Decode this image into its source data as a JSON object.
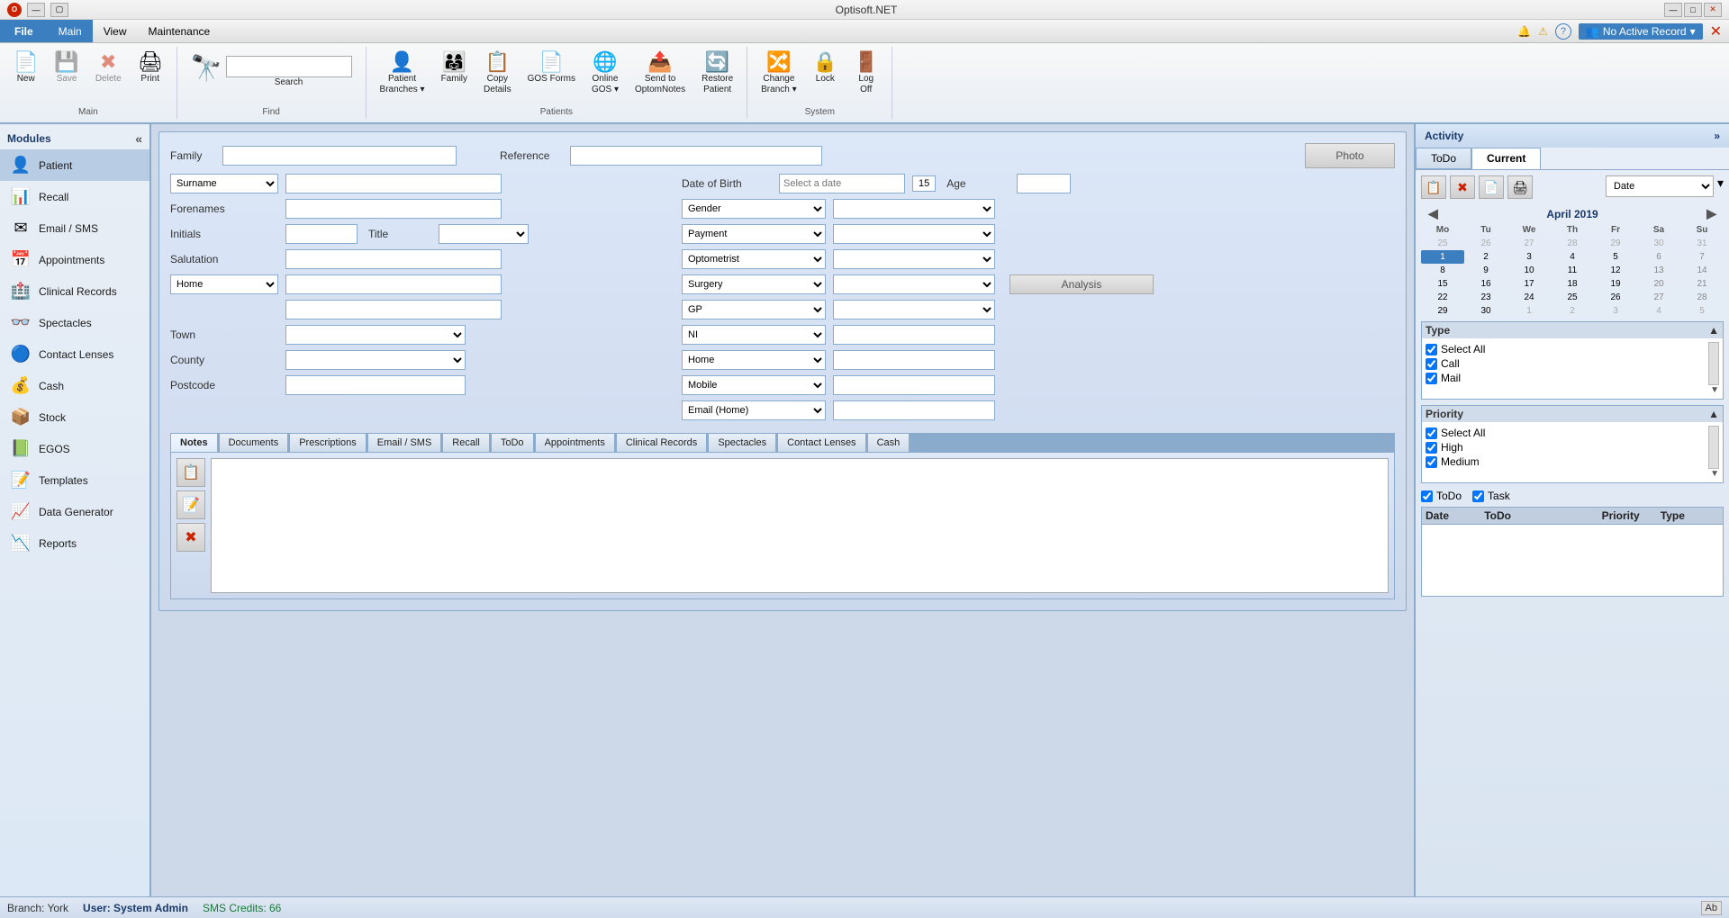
{
  "app": {
    "title": "Optisoft.NET",
    "minimize": "—",
    "maximize": "□",
    "close": "✕"
  },
  "menu": {
    "items": [
      {
        "id": "file",
        "label": "File",
        "active": false
      },
      {
        "id": "main",
        "label": "Main",
        "active": true
      },
      {
        "id": "view",
        "label": "View",
        "active": false
      },
      {
        "id": "maintenance",
        "label": "Maintenance",
        "active": false
      }
    ]
  },
  "ribbon": {
    "groups": [
      {
        "id": "main",
        "label": "Main",
        "buttons": [
          {
            "id": "new",
            "label": "New",
            "icon": "📄",
            "enabled": true
          },
          {
            "id": "save",
            "label": "Save",
            "icon": "💾",
            "enabled": false
          },
          {
            "id": "delete",
            "label": "Delete",
            "icon": "✖",
            "enabled": false
          },
          {
            "id": "print",
            "label": "Print",
            "icon": "🖨",
            "enabled": true
          }
        ]
      },
      {
        "id": "find",
        "label": "Find",
        "has_search": true,
        "search_placeholder": ""
      },
      {
        "id": "patients",
        "label": "Patients",
        "buttons": [
          {
            "id": "patient-branches",
            "label": "Patient Branches",
            "icon": "👤",
            "enabled": true
          },
          {
            "id": "family",
            "label": "Family",
            "icon": "👨‍👩‍👧",
            "enabled": true
          },
          {
            "id": "copy-details",
            "label": "Copy Details",
            "icon": "📋",
            "enabled": true
          },
          {
            "id": "gos-forms",
            "label": "GOS Forms",
            "icon": "📄",
            "enabled": true
          },
          {
            "id": "online-gos",
            "label": "Online GOS",
            "icon": "🌐",
            "enabled": true
          },
          {
            "id": "send-to-optom",
            "label": "Send to OptomNotes",
            "icon": "📤",
            "enabled": true
          },
          {
            "id": "restore-patient",
            "label": "Restore Patient",
            "icon": "🔄",
            "enabled": true
          }
        ]
      },
      {
        "id": "system",
        "label": "System",
        "buttons": [
          {
            "id": "change-branch",
            "label": "Change Branch",
            "icon": "🔀",
            "enabled": true
          },
          {
            "id": "lock",
            "label": "Lock",
            "icon": "🔒",
            "enabled": true
          },
          {
            "id": "log-off",
            "label": "Log Off",
            "icon": "🚪",
            "enabled": true
          }
        ]
      }
    ],
    "top_right": {
      "bell_icon": "🔔",
      "warning_icon": "⚠",
      "help_icon": "❓",
      "user_icon": "👥",
      "no_active_record": "No Active Record",
      "close": "✕"
    }
  },
  "sidebar": {
    "title": "Modules",
    "items": [
      {
        "id": "patient",
        "label": "Patient",
        "icon": "👤"
      },
      {
        "id": "recall",
        "label": "Recall",
        "icon": "📊"
      },
      {
        "id": "email-sms",
        "label": "Email / SMS",
        "icon": "✉"
      },
      {
        "id": "appointments",
        "label": "Appointments",
        "icon": "📅"
      },
      {
        "id": "clinical-records",
        "label": "Clinical Records",
        "icon": "🏥"
      },
      {
        "id": "spectacles",
        "label": "Spectacles",
        "icon": "👓"
      },
      {
        "id": "contact-lenses",
        "label": "Contact Lenses",
        "icon": "🔵"
      },
      {
        "id": "cash",
        "label": "Cash",
        "icon": "💰"
      },
      {
        "id": "stock",
        "label": "Stock",
        "icon": "📦"
      },
      {
        "id": "egos",
        "label": "EGOS",
        "icon": "📗"
      },
      {
        "id": "templates",
        "label": "Templates",
        "icon": "📝"
      },
      {
        "id": "data-generator",
        "label": "Data Generator",
        "icon": "📈"
      },
      {
        "id": "reports",
        "label": "Reports",
        "icon": "📉"
      }
    ]
  },
  "patient_form": {
    "labels": {
      "family": "Family",
      "reference": "Reference",
      "photo": "Photo",
      "surname": "Surname",
      "date_of_birth": "Date of Birth",
      "age": "Age",
      "forenames": "Forenames",
      "gender": "Gender",
      "initials": "Initials",
      "title": "Title",
      "payment": "Payment",
      "salutation": "Salutation",
      "optometrist": "Optometrist",
      "home": "Home",
      "surgery": "Surgery",
      "gp": "GP",
      "ni": "NI",
      "town": "Town",
      "county": "County",
      "postcode": "Postcode",
      "analysis": "Analysis"
    },
    "dropdowns": {
      "surname_options": [
        "Surname"
      ],
      "address_type": [
        "Home"
      ],
      "gender_options": [
        "Gender"
      ],
      "title_options": [
        ""
      ],
      "payment_options": [
        "Payment"
      ],
      "optometrist_options": [
        "Optometrist"
      ],
      "surgery_options": [
        "Surgery"
      ],
      "gp_options": [
        "GP"
      ],
      "ni_options": [
        "NI"
      ],
      "town_options": [
        ""
      ],
      "home_options": [
        "Home"
      ],
      "county_options": [
        ""
      ],
      "mobile_options": [
        "Mobile"
      ],
      "postcode_field": "",
      "email_options": [
        "Email (Home)"
      ]
    },
    "dob_placeholder": "Select a date",
    "dob_day": "15"
  },
  "tabs": {
    "items": [
      {
        "id": "notes",
        "label": "Notes",
        "active": true
      },
      {
        "id": "documents",
        "label": "Documents"
      },
      {
        "id": "prescriptions",
        "label": "Prescriptions"
      },
      {
        "id": "email-sms",
        "label": "Email / SMS"
      },
      {
        "id": "recall",
        "label": "Recall"
      },
      {
        "id": "todo",
        "label": "ToDo"
      },
      {
        "id": "appointments",
        "label": "Appointments"
      },
      {
        "id": "clinical-records",
        "label": "Clinical Records"
      },
      {
        "id": "spectacles",
        "label": "Spectacles"
      },
      {
        "id": "contact-lenses",
        "label": "Contact Lenses"
      },
      {
        "id": "cash",
        "label": "Cash"
      }
    ]
  },
  "activity": {
    "title": "Activity",
    "tabs": [
      {
        "id": "todo",
        "label": "ToDo",
        "active": false
      },
      {
        "id": "current",
        "label": "Current",
        "active": true
      }
    ],
    "date_label": "Date",
    "type_label": "Type",
    "type_items": [
      {
        "id": "select-all",
        "label": "Select All",
        "checked": true
      },
      {
        "id": "call",
        "label": "Call",
        "checked": true
      },
      {
        "id": "mail",
        "label": "Mail",
        "checked": true
      }
    ],
    "priority_label": "Priority",
    "priority_items": [
      {
        "id": "select-all-p",
        "label": "Select All",
        "checked": true
      },
      {
        "id": "high",
        "label": "High",
        "checked": true
      },
      {
        "id": "medium",
        "label": "Medium",
        "checked": true
      }
    ],
    "calendar": {
      "month": "April 2019",
      "days_header": [
        "Mo",
        "Tu",
        "We",
        "Th",
        "Fr",
        "Sa",
        "Su"
      ],
      "weeks": [
        [
          "25",
          "26",
          "27",
          "28",
          "29",
          "30",
          "31"
        ],
        [
          "1",
          "2",
          "3",
          "4",
          "5",
          "6",
          "7"
        ],
        [
          "8",
          "9",
          "10",
          "11",
          "12",
          "13",
          "14"
        ],
        [
          "15",
          "16",
          "17",
          "18",
          "19",
          "20",
          "21"
        ],
        [
          "22",
          "23",
          "24",
          "25",
          "26",
          "27",
          "28"
        ],
        [
          "29",
          "30",
          "1",
          "2",
          "3",
          "4",
          "5"
        ]
      ],
      "today": "1",
      "other_month_start": [
        "25",
        "26",
        "27",
        "28",
        "29",
        "30",
        "31"
      ],
      "other_month_end": [
        "1",
        "2",
        "3",
        "4",
        "5"
      ]
    },
    "bottom_checks": [
      {
        "id": "todo-chk",
        "label": "ToDo",
        "checked": true
      },
      {
        "id": "task-chk",
        "label": "Task",
        "checked": true
      }
    ],
    "table_cols": [
      "Date",
      "ToDo",
      "Priority",
      "Type"
    ]
  },
  "status_bar": {
    "branch": "Branch: York",
    "user": "User: System Admin",
    "sms": "SMS Credits: 66",
    "ab": "Ab"
  }
}
